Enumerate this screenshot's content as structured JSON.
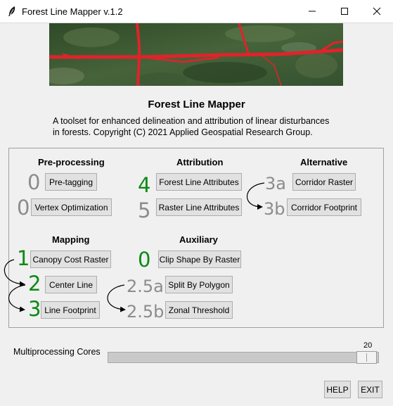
{
  "window": {
    "title": "Forest Line Mapper v.1.2",
    "icon": "feather-icon",
    "controls": [
      "minimize-icon",
      "maximize-icon",
      "close-icon"
    ]
  },
  "banner": {
    "description": "aerial forest imagery with red linear disturbance lines"
  },
  "header": {
    "title": "Forest Line Mapper",
    "description_line1": "A toolset for enhanced delineation and attribution of linear disturbances",
    "description_line2": "in forests. Copyright (C) 2021 Applied Geospatial Research Group."
  },
  "sections": {
    "preprocessing": {
      "title": "Pre-processing",
      "steps": [
        {
          "number": "0",
          "label": "Pre-tagging",
          "active": false
        },
        {
          "number": "0",
          "label": "Vertex Optimization",
          "active": false
        }
      ]
    },
    "attribution": {
      "title": "Attribution",
      "steps": [
        {
          "number": "4",
          "label": "Forest Line Attributes",
          "active": true
        },
        {
          "number": "5",
          "label": "Raster Line Attributes",
          "active": false
        }
      ]
    },
    "alternative": {
      "title": "Alternative",
      "steps": [
        {
          "number": "3a",
          "label": "Corridor Raster",
          "active": false
        },
        {
          "number": "3b",
          "label": "Corridor Footprint",
          "active": false
        }
      ]
    },
    "mapping": {
      "title": "Mapping",
      "steps": [
        {
          "number": "1",
          "label": "Canopy Cost Raster",
          "active": true
        },
        {
          "number": "2",
          "label": "Center Line",
          "active": true
        },
        {
          "number": "3",
          "label": "Line Footprint",
          "active": true
        }
      ]
    },
    "auxiliary": {
      "title": "Auxiliary",
      "steps": [
        {
          "number": "0",
          "label": "Clip Shape By Raster",
          "active": true
        },
        {
          "number": "2.5a",
          "label": "Split By Polygon",
          "active": false
        },
        {
          "number": "2.5b",
          "label": "Zonal Threshold",
          "active": false
        }
      ]
    }
  },
  "multiprocessing": {
    "label": "Multiprocessing Cores",
    "value": "20",
    "fraction": 1.0
  },
  "footer": {
    "help_label": "HELP",
    "exit_label": "EXIT"
  },
  "colors": {
    "active_step": "#0b8a16",
    "inactive_step": "#8c8c8c",
    "banner_lines": "#e0232a"
  }
}
